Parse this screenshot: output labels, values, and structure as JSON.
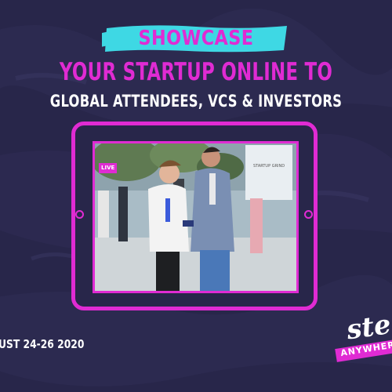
{
  "colors": {
    "background": "#28264a",
    "accent_magenta": "#e02bd3",
    "accent_cyan": "#3ed8e4",
    "text_white": "#ffffff"
  },
  "headline": {
    "badge_text": "SHOWCASE",
    "line2": "YOUR STARTUP ONLINE TO",
    "line3": "GLOBAL ATTENDEES, VCS & INVESTORS"
  },
  "tablet": {
    "screen_badge": "LIVE",
    "banner_text": "STARTUP GRIND"
  },
  "footer": {
    "date": "UST 24-26 2020"
  },
  "logo": {
    "word": "step",
    "tagline": "ANYWHERE"
  }
}
